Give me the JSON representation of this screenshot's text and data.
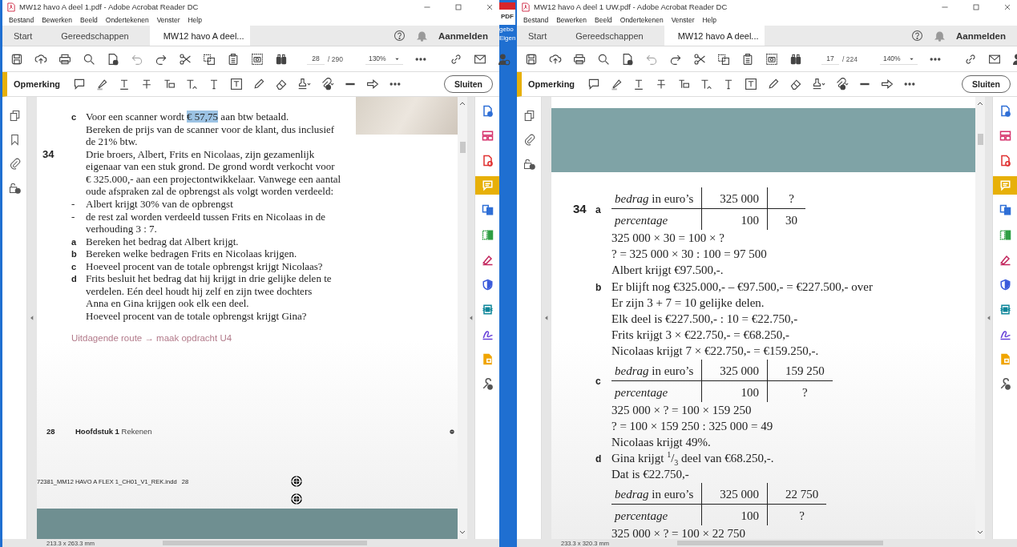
{
  "desktop_icon": {
    "badge": "PDF",
    "label_lines": [
      "gebo",
      "Eigen"
    ]
  },
  "windows": [
    {
      "title": "MW12 havo A deel 1.pdf - Adobe Acrobat Reader DC",
      "menu": [
        "Bestand",
        "Bewerken",
        "Beeld",
        "Ondertekenen",
        "Venster",
        "Help"
      ],
      "tabs": [
        {
          "label": "Start",
          "selected": false
        },
        {
          "label": "Gereedschappen",
          "selected": false
        },
        {
          "label": "MW12 havo A deel...",
          "selected": true
        }
      ],
      "account": "Aanmelden",
      "page_number": "28",
      "page_count": "/ 290",
      "zoom": "130%",
      "comment_label": "Opmerking",
      "close_button": "Sluiten",
      "left_rail": [
        {
          "kind": "pages"
        },
        {
          "kind": "bookmark"
        },
        {
          "kind": "attachment"
        },
        {
          "kind": "security"
        }
      ],
      "right_tools": [
        {
          "color": "#2f6fd6",
          "selected": false
        },
        {
          "color": "#d6336c",
          "selected": false
        },
        {
          "color": "#e03131",
          "selected": false
        },
        {
          "selected": true
        },
        {
          "color": "#2f6fd6",
          "selected": false
        },
        {
          "color": "#2f9e44",
          "selected": false
        },
        {
          "color": "#c2255c",
          "selected": false
        },
        {
          "color": "#3b5bdb",
          "selected": false
        },
        {
          "color": "#0c8599",
          "selected": false
        },
        {
          "color": "#6741d9",
          "selected": false
        },
        {
          "color": "#f0a500",
          "selected": false
        },
        {
          "color": "#555555",
          "selected": false
        }
      ],
      "page": {
        "photo": true,
        "blocks": [
          {
            "kind": "item",
            "label": "c",
            "lines": [
              [
                {
                  "text": "Voor een scanner wordt ",
                  "selected": false
                },
                {
                  "text": "€ 57,75",
                  "selected": true
                },
                {
                  "text": " aan btw betaald.",
                  "selected": false
                }
              ],
              "Bereken de prijs van de scanner voor de klant, dus inclusief",
              "de 21% btw."
            ]
          },
          {
            "kind": "item",
            "number": "34",
            "lines": [
              "Drie broers, Albert, Frits en Nicolaas, zijn gezamenlijk",
              "eigenaar van een stuk grond. De grond wordt verkocht voor",
              "€ 325.000,- aan een projectontwikkelaar. Vanwege een aantal",
              "oude afspraken zal de opbrengst als volgt worden verdeeld:"
            ]
          },
          {
            "kind": "item",
            "label": "-",
            "lines": [
              "Albert krijgt 30% van de opbrengst"
            ]
          },
          {
            "kind": "item",
            "label": "-",
            "lines": [
              "de rest zal worden verdeeld tussen Frits en Nicolaas in de",
              "verhouding 3 : 7."
            ]
          },
          {
            "kind": "item",
            "label": "a",
            "lines": [
              "Bereken het bedrag dat Albert krijgt."
            ]
          },
          {
            "kind": "item",
            "label": "b",
            "lines": [
              "Bereken welke bedragen Frits en Nicolaas krijgen."
            ]
          },
          {
            "kind": "item",
            "label": "c",
            "lines": [
              "Hoeveel procent van de totale opbrengst krijgt Nicolaas?"
            ]
          },
          {
            "kind": "item",
            "label": "d",
            "lines": [
              "Frits besluit het bedrag dat hij krijgt in drie gelijke delen te",
              "verdelen. Eén deel houdt hij zelf en zijn twee dochters",
              "Anna en Gina krijgen ook elk een deel.",
              "Hoeveel procent van de totale opbrengst krijgt Gina?"
            ]
          },
          {
            "kind": "link",
            "text": "Uitdagende route → maak opdracht U4"
          },
          {
            "kind": "footer",
            "number": "28",
            "chapter": "Hoofdstuk 1",
            "title": "Rekenen"
          },
          {
            "kind": "slug",
            "text": "72381_MM12 HAVO A FLEX 1_CH01_V1_REK.indd   28"
          },
          {
            "kind": "band"
          }
        ]
      },
      "status": "213.3 x 263.3 mm"
    },
    {
      "title": "MW12 havo A deel 1 UW.pdf - Adobe Acrobat Reader DC",
      "menu": [
        "Bestand",
        "Bewerken",
        "Beeld",
        "Ondertekenen",
        "Venster",
        "Help"
      ],
      "tabs": [
        {
          "label": "Start",
          "selected": false
        },
        {
          "label": "Gereedschappen",
          "selected": false
        },
        {
          "label": "MW12 havo A deel...",
          "selected": true
        }
      ],
      "account": "Aanmelden",
      "page_number": "17",
      "page_count": "/ 224",
      "zoom": "140%",
      "comment_label": "Opmerking",
      "close_button": "Sluiten",
      "left_rail": [
        {
          "kind": "pages"
        },
        {
          "kind": "attachment"
        },
        {
          "kind": "security"
        }
      ],
      "right_tools": [
        {
          "color": "#2f6fd6",
          "selected": false
        },
        {
          "color": "#d6336c",
          "selected": false
        },
        {
          "color": "#e03131",
          "selected": false
        },
        {
          "selected": true
        },
        {
          "color": "#2f6fd6",
          "selected": false
        },
        {
          "color": "#2f9e44",
          "selected": false
        },
        {
          "color": "#c2255c",
          "selected": false
        },
        {
          "color": "#3b5bdb",
          "selected": false
        },
        {
          "color": "#0c8599",
          "selected": false
        },
        {
          "color": "#6741d9",
          "selected": false
        },
        {
          "color": "#f0a500",
          "selected": false
        },
        {
          "color": "#555555",
          "selected": false
        }
      ],
      "page": {
        "blocks": [
          {
            "kind": "band"
          },
          {
            "kind": "table",
            "number": "34",
            "label": "a",
            "rows": [
              [
                "*bedrag* in euro’s",
                "325 000",
                "?"
              ],
              [
                "percentage",
                "100",
                "30"
              ]
            ]
          },
          {
            "kind": "item",
            "lines": [
              "325 000 × 30 = 100 × ?",
              "? = 325 000 × 30 : 100 = 97 500",
              "Albert krijgt €97.500,-."
            ]
          },
          {
            "kind": "item",
            "label": "b",
            "lines": [
              "Er blijft nog €325.000,- – €97.500,- = €227.500,- over",
              "Er zijn 3 + 7 = 10 gelijke delen.",
              "Elk deel is €227.500,-  :  10 = €22.750,-",
              "Frits krijgt 3 × €22.750,- = €68.250,-",
              "Nicolaas krijgt 7 × €22.750,- = €159.250,-."
            ]
          },
          {
            "kind": "table",
            "label": "c",
            "rows": [
              [
                "*bedrag* in euro’s",
                "325 000",
                "159 250"
              ],
              [
                "percentage",
                "100",
                "?"
              ]
            ]
          },
          {
            "kind": "item",
            "lines": [
              "325 000 × ? = 100 × 159 250",
              "? = 100 × 159 250 : 325 000 = 49",
              "Nicolaas krijgt 49%."
            ]
          },
          {
            "kind": "item",
            "label": "d",
            "lines": [
              "Gina krijgt $^{1}$/$_{3}$ deel van €68.250,-.",
              "Dat is €22.750,-"
            ]
          },
          {
            "kind": "table",
            "rows": [
              [
                "*bedrag* in euro’s",
                "325 000",
                "22 750"
              ],
              [
                "percentage",
                "100",
                "?"
              ]
            ]
          },
          {
            "kind": "item",
            "lines": [
              "325 000 × ? = 100 × 22 750"
            ]
          }
        ]
      },
      "status": "233.3 x 320.3 mm"
    }
  ]
}
